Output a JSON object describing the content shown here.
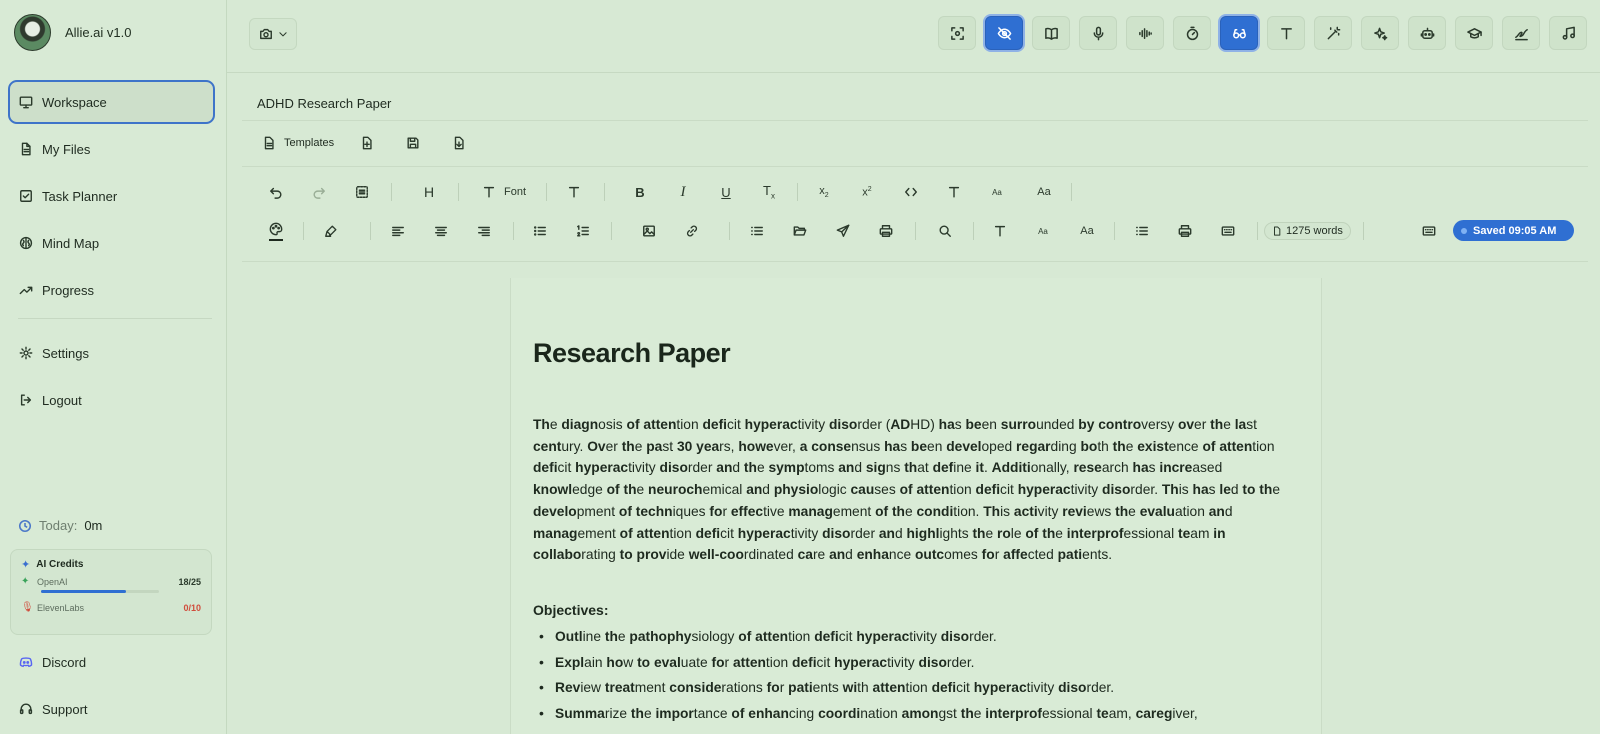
{
  "app": {
    "name": "Allie.ai v1.0"
  },
  "sidebar": {
    "items": [
      {
        "label": "Workspace",
        "icon": "monitor-icon",
        "active": true
      },
      {
        "label": "My Files",
        "icon": "file-icon"
      },
      {
        "label": "Task Planner",
        "icon": "check-square-icon"
      },
      {
        "label": "Mind Map",
        "icon": "brain-icon"
      },
      {
        "label": "Progress",
        "icon": "trending-up-icon"
      },
      {
        "label": "Settings",
        "icon": "gear-icon"
      },
      {
        "label": "Logout",
        "icon": "logout-icon"
      }
    ],
    "today": {
      "label": "Today:",
      "value": "0m"
    },
    "credits": {
      "title": "AI Credits",
      "openai": {
        "label": "OpenAI",
        "value": "18/25",
        "used": 18,
        "total": 25
      },
      "elevenlabs": {
        "label": "ElevenLabs",
        "value": "0/10",
        "used": 0,
        "total": 10
      }
    },
    "footer": [
      {
        "label": "Discord",
        "icon": "discord-icon"
      },
      {
        "label": "Support",
        "icon": "headset-icon"
      }
    ]
  },
  "toolbar": {
    "active_tools": [
      "eye-off-icon",
      "glasses-icon"
    ],
    "tools": [
      "focus-icon",
      "eye-off-icon",
      "book-icon",
      "mic-icon",
      "waveform-icon",
      "timer-icon",
      "glasses-icon",
      "text-icon",
      "magic-wand-icon",
      "sparkles-icon",
      "robot-icon",
      "graduation-cap-icon",
      "signature-icon",
      "music-icon"
    ]
  },
  "document": {
    "name": "ADHD Research Paper",
    "templates_label": "Templates",
    "font_label": "Font",
    "word_count": "1275 words",
    "saved_status": "Saved 09:05 AM",
    "heading": "Research Paper",
    "paragraph": "The diagnosis of attention deficit hyperactivity disorder (ADHD) has been surrounded by controversy over the last century. Over the past 30 years, however, a consensus has been developed regarding both the existence of attention deficit hyperactivity disorder and the symptoms and signs that define it. Additionally, research has increased knowledge of the neurochemical and physiologic causes of attention deficit hyperactivity disorder. This has led to the development of techniques for effective management of the condition. This activity reviews the evaluation and management of attention deficit hyperactivity disorder and highlights the role of the interprofessional team in collaborating to provide well-coordinated care and enhance outcomes for affected patients.",
    "objectives_label": "Objectives:",
    "objectives": [
      "Outline the pathophysiology of attention deficit hyperactivity disorder.",
      "Explain how to evaluate for attention deficit hyperactivity disorder.",
      "Review treatment considerations for patients with attention deficit hyperactivity disorder.",
      "Summarize the importance of enhancing coordination amongst the interprofessional team, caregiver,"
    ]
  },
  "colors": {
    "accent": "#2f6fd2",
    "background": "#d7e9d4",
    "danger": "#d04d3c"
  }
}
